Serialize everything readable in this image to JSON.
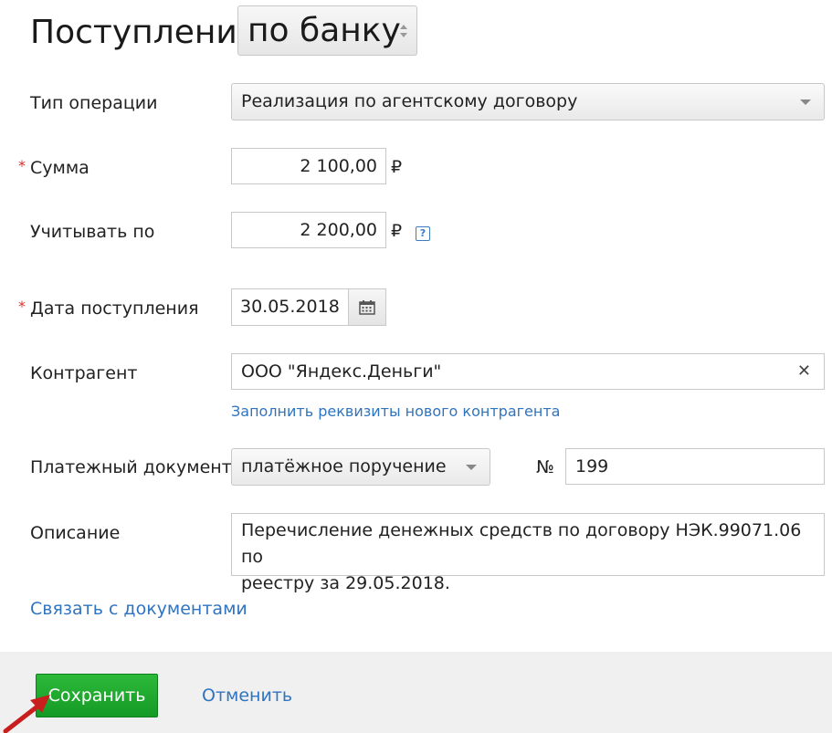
{
  "header": {
    "title": "Поступление",
    "type_select": "по банку"
  },
  "form": {
    "operation_type": {
      "label": "Тип операции",
      "value": "Реализация по агентскому договору"
    },
    "required_mark": "*",
    "amount": {
      "label": "Сумма",
      "value": "2 100,00",
      "currency": "₽"
    },
    "account_by": {
      "label": "Учитывать по",
      "value": "2 200,00",
      "currency": "₽",
      "help": "?"
    },
    "receipt_date": {
      "label": "Дата поступления",
      "value": "30.05.2018"
    },
    "counterparty": {
      "label": "Контрагент",
      "value": "ООО \"Яндекс.Деньги\"",
      "clear": "✕",
      "fill_link": "Заполнить реквизиты нового контрагента"
    },
    "payment_doc": {
      "label": "Платежный документ",
      "value": "платёжное поручение",
      "number_label": "№",
      "number": "199"
    },
    "description": {
      "label": "Описание",
      "line1": "Перечисление денежных средств по договору НЭК.99071.06 по",
      "line2": "реестру за 29.05.2018."
    },
    "link_docs": "Связать с документами"
  },
  "footer": {
    "save": "Сохранить",
    "cancel": "Отменить"
  },
  "colors": {
    "link": "#2f74c0",
    "required": "#d9322e",
    "save": "#1fa82f",
    "annotation_arrow": "#c81e1e"
  }
}
